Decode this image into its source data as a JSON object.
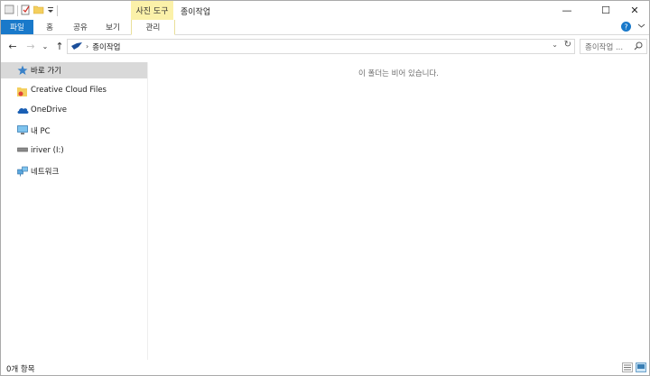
{
  "titlebar": {
    "context_tab_label": "사진 도구",
    "window_title": "종이작업",
    "minimize": "—",
    "maximize": "☐",
    "close": "✕"
  },
  "ribbon": {
    "tabs": [
      {
        "label": "파일"
      },
      {
        "label": "홈"
      },
      {
        "label": "공유"
      },
      {
        "label": "보기"
      },
      {
        "label": "관리"
      }
    ]
  },
  "navigation": {
    "back": "←",
    "forward": "→",
    "recent": "⌄",
    "up": "↑",
    "breadcrumb_folder": "종이작업",
    "search_placeholder": "종이작업 ..."
  },
  "nav_pane": {
    "items": [
      {
        "label": "바로 가기",
        "icon": "star-icon",
        "selected": true
      },
      {
        "label": "Creative Cloud Files",
        "icon": "creative-cloud-folder-icon",
        "selected": false
      },
      {
        "label": "OneDrive",
        "icon": "onedrive-cloud-icon",
        "selected": false
      },
      {
        "label": "내 PC",
        "icon": "pc-monitor-icon",
        "selected": false
      },
      {
        "label": "iriver (I:)",
        "icon": "drive-icon",
        "selected": false
      },
      {
        "label": "네트워크",
        "icon": "network-icon",
        "selected": false
      }
    ]
  },
  "content": {
    "empty_message": "이 폴더는 비어 있습니다."
  },
  "status_bar": {
    "item_count": "0개 항목"
  },
  "colors": {
    "file_tab": "#1979ca",
    "context_tab": "#fbf1a9",
    "selected_item": "#d9d9d9"
  }
}
